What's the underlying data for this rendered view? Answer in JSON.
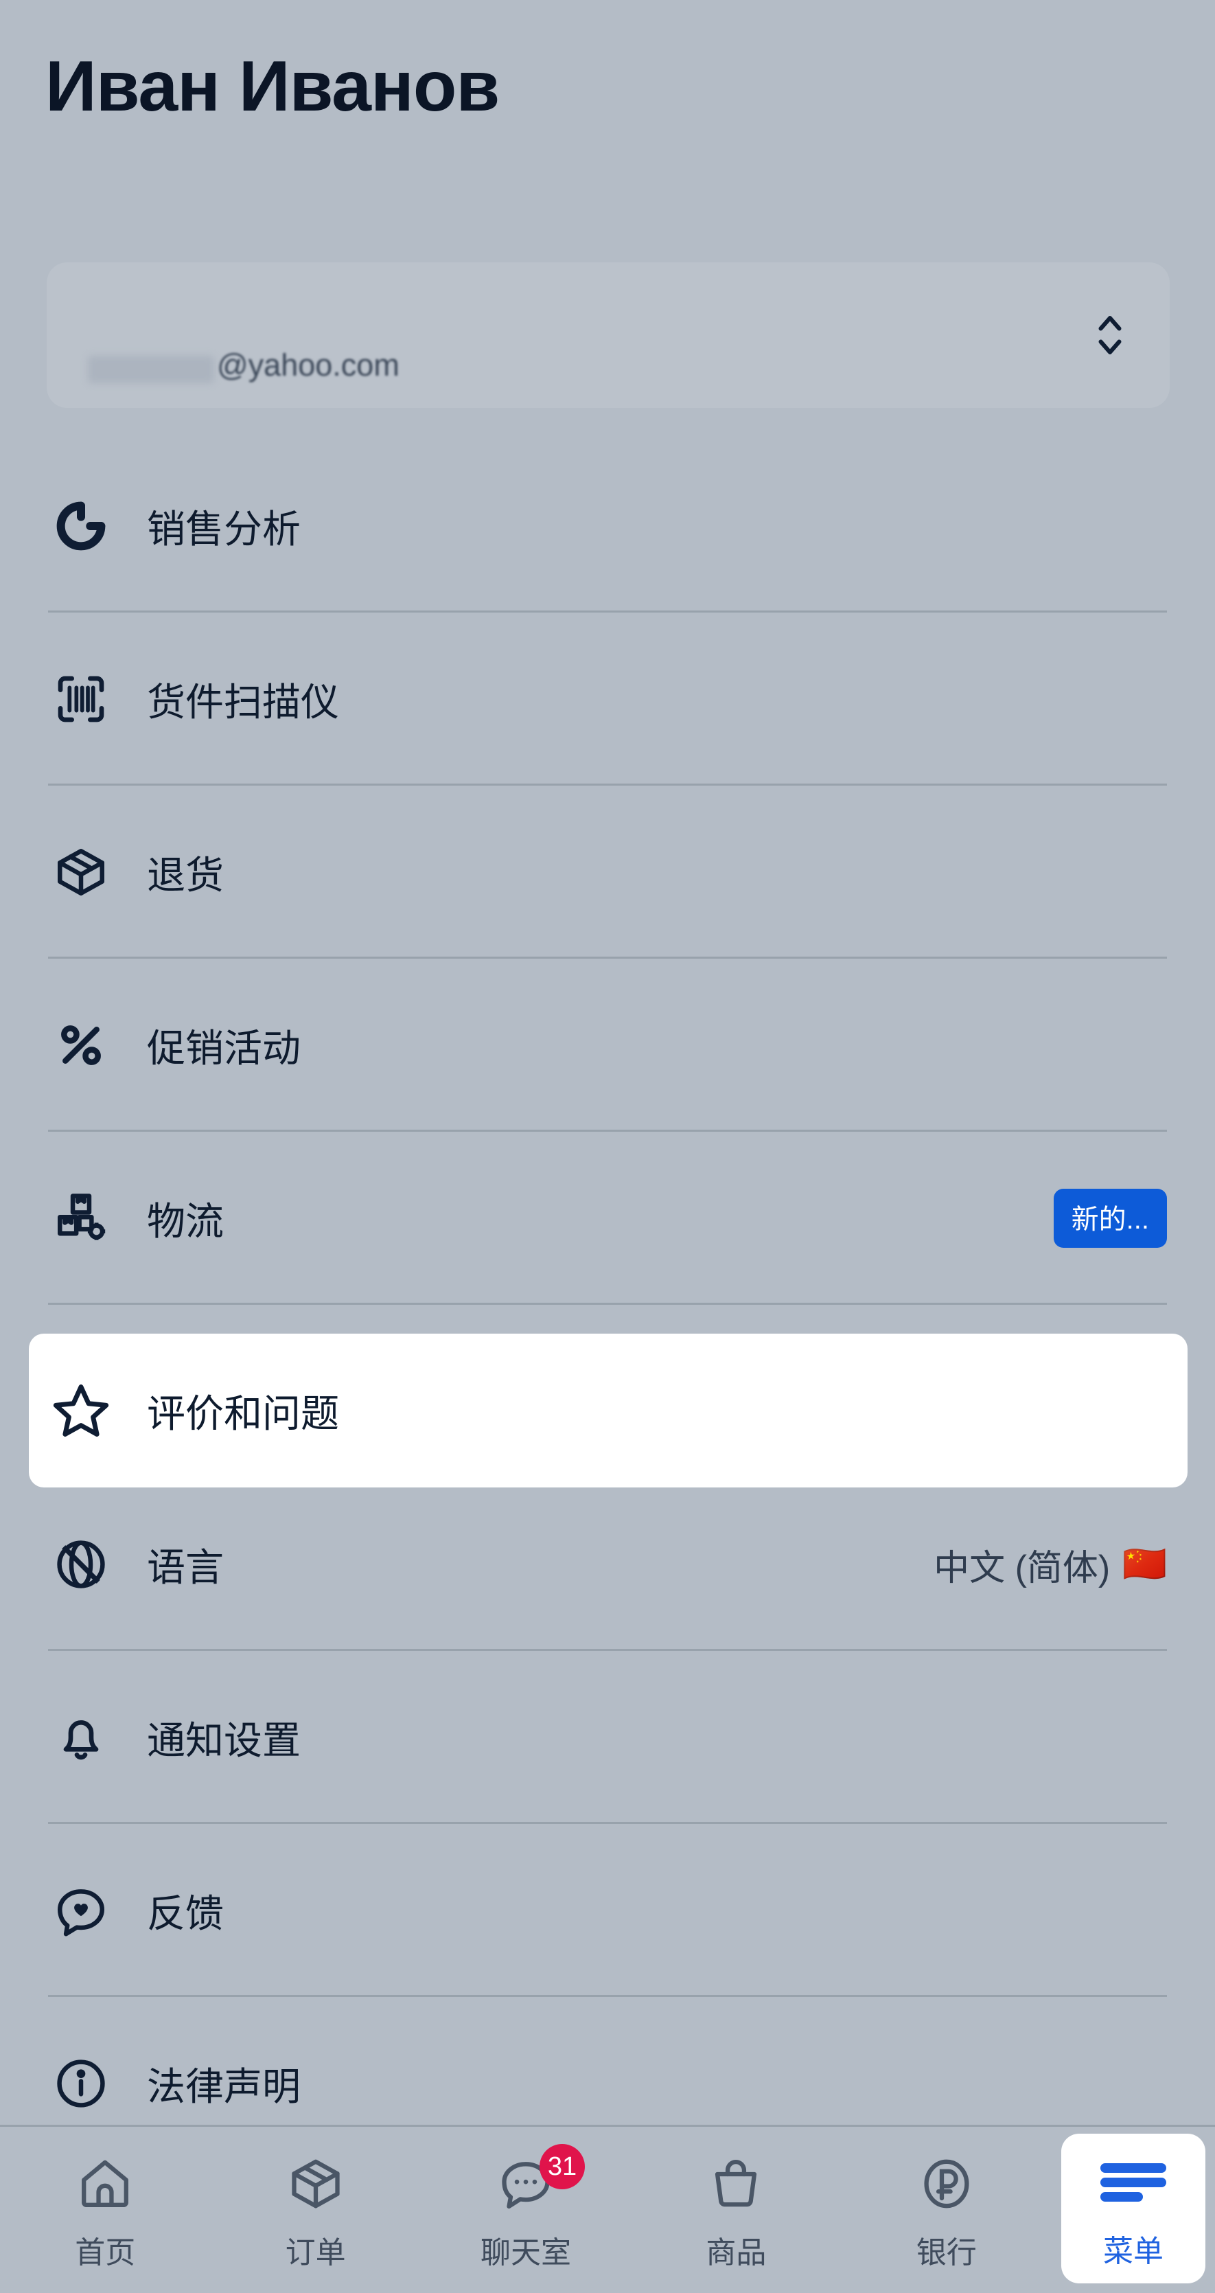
{
  "header": {
    "profile_name": "Иван Иванов"
  },
  "account_selector": {
    "email_visible": "@yahoo.com",
    "selector_icon": "chevron-up-down-icon"
  },
  "menu": {
    "items": [
      {
        "id": "sales-analytics",
        "icon": "pie-chart-icon",
        "label": "销售分析"
      },
      {
        "id": "shipment-scanner",
        "icon": "barcode-scan-icon",
        "label": "货件扫描仪"
      },
      {
        "id": "returns",
        "icon": "open-box-icon",
        "label": "退货"
      },
      {
        "id": "promotions",
        "icon": "percent-icon",
        "label": "促销活动"
      },
      {
        "id": "logistics",
        "icon": "boxes-gear-icon",
        "label": "物流",
        "badge": "新的..."
      },
      {
        "id": "reviews-questions",
        "icon": "star-icon",
        "label": "评价和问题",
        "highlighted": true
      },
      {
        "id": "language",
        "icon": "globe-slash-icon",
        "label": "语言",
        "value": "中文 (简体)",
        "flag": "🇨🇳"
      },
      {
        "id": "notifications",
        "icon": "bell-icon",
        "label": "通知设置"
      },
      {
        "id": "feedback",
        "icon": "heart-chat-icon",
        "label": "反馈"
      },
      {
        "id": "legal",
        "icon": "info-circle-icon",
        "label": "法律声明"
      }
    ]
  },
  "bottom_nav": {
    "items": [
      {
        "id": "home",
        "icon": "home-icon",
        "label": "首页"
      },
      {
        "id": "orders",
        "icon": "box-3d-icon",
        "label": "订单"
      },
      {
        "id": "chat",
        "icon": "chat-bubble-icon",
        "label": "聊天室",
        "badge": "31"
      },
      {
        "id": "products",
        "icon": "shopping-bag-icon",
        "label": "商品"
      },
      {
        "id": "bank",
        "icon": "ruble-circle-icon",
        "label": "银行"
      },
      {
        "id": "menu",
        "icon": "hamburger-icon",
        "label": "菜单",
        "active": true
      }
    ]
  },
  "colors": {
    "background": "#b4bcc6",
    "text_primary": "#0e1b2e",
    "badge_blue": "#0d5bd8",
    "badge_red": "#e0144b",
    "accent_blue": "#1f62e0",
    "highlight_card": "#ffffff"
  }
}
